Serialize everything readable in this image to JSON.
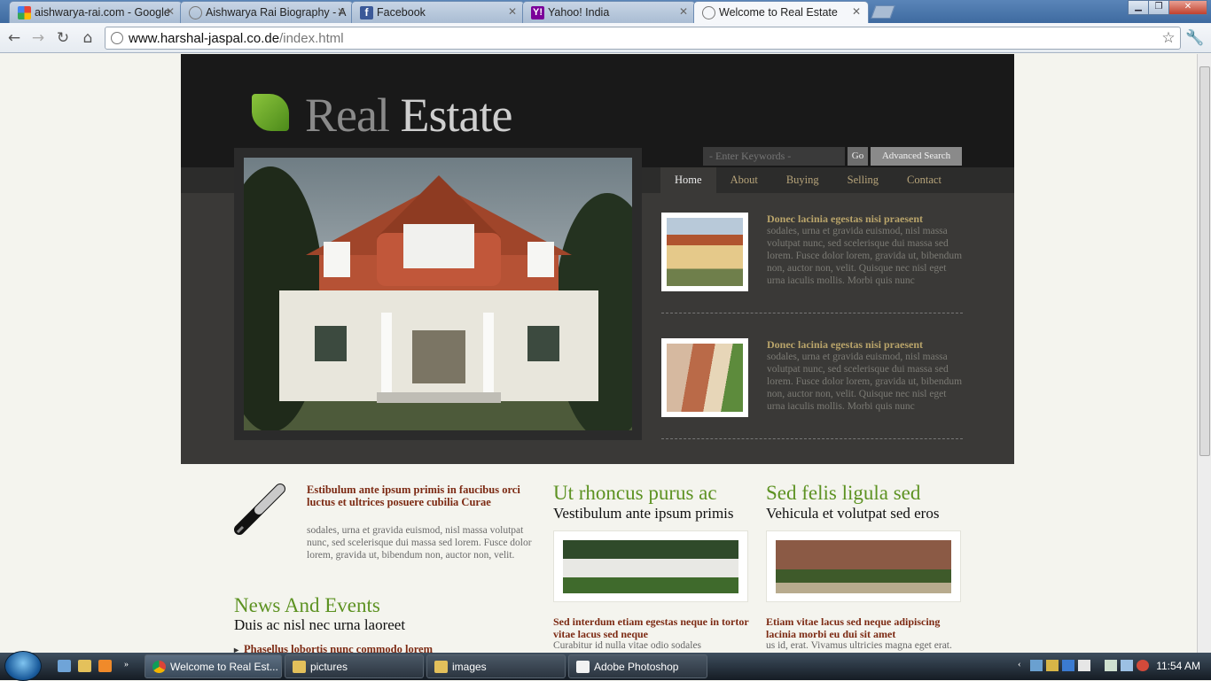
{
  "browser": {
    "tabs": [
      {
        "label": "aishwarya-rai.com - Google",
        "icon": "google-icon",
        "color": "#4a8af4"
      },
      {
        "label": "Aishwarya Rai Biography - A",
        "icon": "globe-icon",
        "color": "#888888"
      },
      {
        "label": "Facebook",
        "icon": "facebook-icon",
        "color": "#3b5998"
      },
      {
        "label": "Yahoo! India",
        "icon": "yahoo-icon",
        "color": "#7b0099"
      },
      {
        "label": "Welcome to Real Estate",
        "icon": "globe-icon",
        "color": "#888888"
      }
    ],
    "url_host": "www.harshal-jaspal.co.de",
    "url_path": "/index.html"
  },
  "site": {
    "logo_dark": "Real",
    "logo_light": "Estate",
    "search_placeholder": "- Enter Keywords -",
    "go_label": "Go",
    "advanced_label": "Advanced Search",
    "nav": [
      "Home",
      "About",
      "Buying",
      "Selling",
      "Contact"
    ],
    "features": [
      {
        "title": "Donec lacinia egestas nisi praesent",
        "text": "sodales, urna et gravida euismod, nisl massa volutpat nunc, sed scelerisque dui massa sed lorem. Fusce dolor lorem, gravida ut, bibendum non, auctor non, velit. Quisque nec nisl eget urna iaculis mollis. Morbi quis nunc"
      },
      {
        "title": "Donec lacinia egestas nisi praesent",
        "text": "sodales, urna et gravida euismod, nisl massa volutpat nunc, sed scelerisque dui massa sed lorem. Fusce dolor lorem, gravida ut, bibendum non, auctor non, velit. Quisque nec nisl eget urna iaculis mollis. Morbi quis nunc"
      }
    ],
    "intro": {
      "title": "Estibulum ante ipsum primis in faucibus orci luctus et ultrices posuere cubilia Curae",
      "text": "sodales, urna et gravida euismod, nisl massa volutpat nunc, sed scelerisque dui massa sed lorem. Fusce dolor lorem, gravida ut, bibendum non, auctor non, velit."
    },
    "news": {
      "title": "News And Events",
      "subtitle": "Duis ac nisl nec urna laoreet",
      "item": "Phasellus lobortis nunc commodo lorem"
    },
    "columns": [
      {
        "title": "Ut rhoncus purus ac",
        "subtitle": "Vestibulum ante ipsum primis",
        "heading": "Sed interdum etiam egestas neque in tortor vitae lacus sed neque",
        "text": "Curabitur id nulla vitae odio sodales"
      },
      {
        "title": "Sed felis ligula sed",
        "subtitle": "Vehicula et volutpat sed eros",
        "heading": "Etiam vitae lacus sed neque adipiscing lacinia morbi eu dui sit amet",
        "text": "us id, erat. Vivamus ultricies magna eget erat."
      }
    ]
  },
  "taskbar": {
    "buttons": [
      {
        "label": "Welcome to Real Est...",
        "icon": "chrome-icon"
      },
      {
        "label": "pictures",
        "icon": "folder-icon"
      },
      {
        "label": "images",
        "icon": "folder-icon"
      },
      {
        "label": "Adobe Photoshop",
        "icon": "document-icon"
      }
    ],
    "clock": "11:54 AM"
  }
}
